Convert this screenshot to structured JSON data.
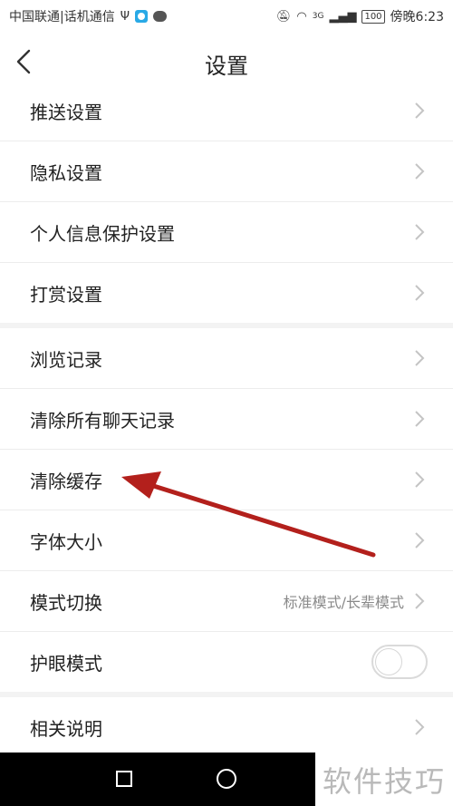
{
  "status_bar": {
    "carrier": "中国联通|话机通信",
    "usb_icon": "usb-icon",
    "app_icon": "app-notification-icon",
    "chat_icon": "chat-bubble-icon",
    "mute_icon": "mute-icon",
    "wifi_icon": "wifi-icon",
    "signal_label": "3G",
    "battery": "100",
    "time": "傍晚6:23"
  },
  "header": {
    "back_icon": "chevron-left-icon",
    "title": "设置"
  },
  "settings": {
    "items": [
      {
        "label": "推送设置",
        "type": "link"
      },
      {
        "label": "隐私设置",
        "type": "link"
      },
      {
        "label": "个人信息保护设置",
        "type": "link"
      },
      {
        "label": "打赏设置",
        "type": "link"
      },
      {
        "label": "浏览记录",
        "type": "link"
      },
      {
        "label": "清除所有聊天记录",
        "type": "link"
      },
      {
        "label": "清除缓存",
        "type": "link"
      },
      {
        "label": "字体大小",
        "type": "link"
      },
      {
        "label": "模式切换",
        "type": "link",
        "value": "标准模式/长辈模式"
      },
      {
        "label": "护眼模式",
        "type": "toggle",
        "on": false
      },
      {
        "label": "相关说明",
        "type": "link"
      }
    ]
  },
  "annotation": {
    "arrow_color": "#b3201c",
    "points_to": "清除缓存"
  },
  "nav_bar": {
    "recents_icon": "square-recents-icon",
    "home_icon": "circle-home-icon"
  },
  "watermark": "软件技巧"
}
